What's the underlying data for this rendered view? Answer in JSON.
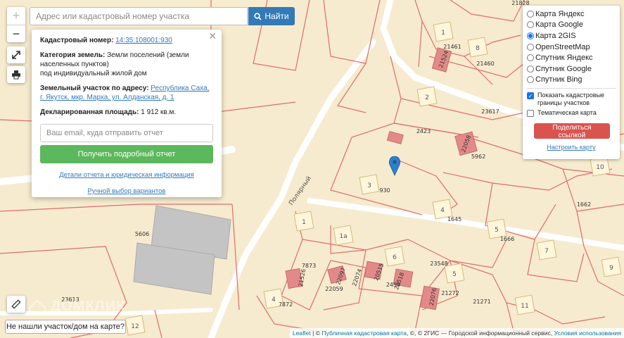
{
  "map": {
    "plot_numbers": [
      "1",
      "2",
      "3",
      "4",
      "5",
      "6",
      "7",
      "1",
      "1а",
      "8",
      "10",
      "11",
      "12",
      "9",
      "4",
      "5"
    ],
    "cadastral_labels": [
      "21828",
      "21461",
      "21460",
      "2423",
      "23617",
      "5962",
      "930",
      "1662",
      "1645",
      "1666",
      "5606",
      "23548",
      "7873",
      "22059",
      "2459",
      "21272",
      "21271",
      "7872",
      "23613",
      "22058",
      "21524",
      "21526",
      "22097",
      "20515",
      "22076",
      "20518",
      "22074"
    ],
    "street_label": "Полярный",
    "watermark": "ДОМКЛИК"
  },
  "search": {
    "placeholder": "Адрес или кадастровый номер участка",
    "button_label": "Найти"
  },
  "popup": {
    "cad_number_label": "Кадастровый номер:",
    "cad_number": "14:35:108001:930",
    "category_label": "Категория земель:",
    "category": "Земли поселений (земли населенных пунктов)",
    "usage": "под индивидуальный жилой дом",
    "address_label": "Земельный участок по адресу:",
    "address": "Республика Саха, г. Якутск, мкр. Марха, ул. Алданская, д. 1",
    "area_label": "Декларированная площадь:",
    "area": "1 912 кв.м.",
    "email_placeholder": "Ваш email, куда отправить отчет",
    "report_button": "Получить подробный отчет",
    "details_link": "Детали отчета и юридическая информация",
    "manual_link": "Ручной выбор вариантов"
  },
  "layers": {
    "options": [
      "Карта Яндекс",
      "Карта Google",
      "Карта 2GIS",
      "OpenStreetMap",
      "Спутник Яндекс",
      "Спутник Google",
      "Спутник Bing"
    ],
    "selected": "Карта 2GIS",
    "show_cadastral": "Показать кадастровые границы участков",
    "thematic": "Тематическая карта",
    "share_button": "Поделиться ссылкой",
    "setup_link": "Настроить карту"
  },
  "notfound_button": "Не нашли участок/дом на карте?",
  "attribution": {
    "leaflet": "Leaflet",
    "text1": " | © ",
    "pkk": "Публичная кадастровая карта",
    "text2": ", ©, © 2ГИС — Городской информационный сервис, ",
    "terms": "Условия использования"
  },
  "colors": {
    "map_bg": "#f6ebcf",
    "parcel_line": "#e26b6b",
    "road": "#ffffff",
    "building": "#bdbdbd",
    "parcel_fill": "#e28a8a",
    "marker": "#2f7fc9"
  }
}
